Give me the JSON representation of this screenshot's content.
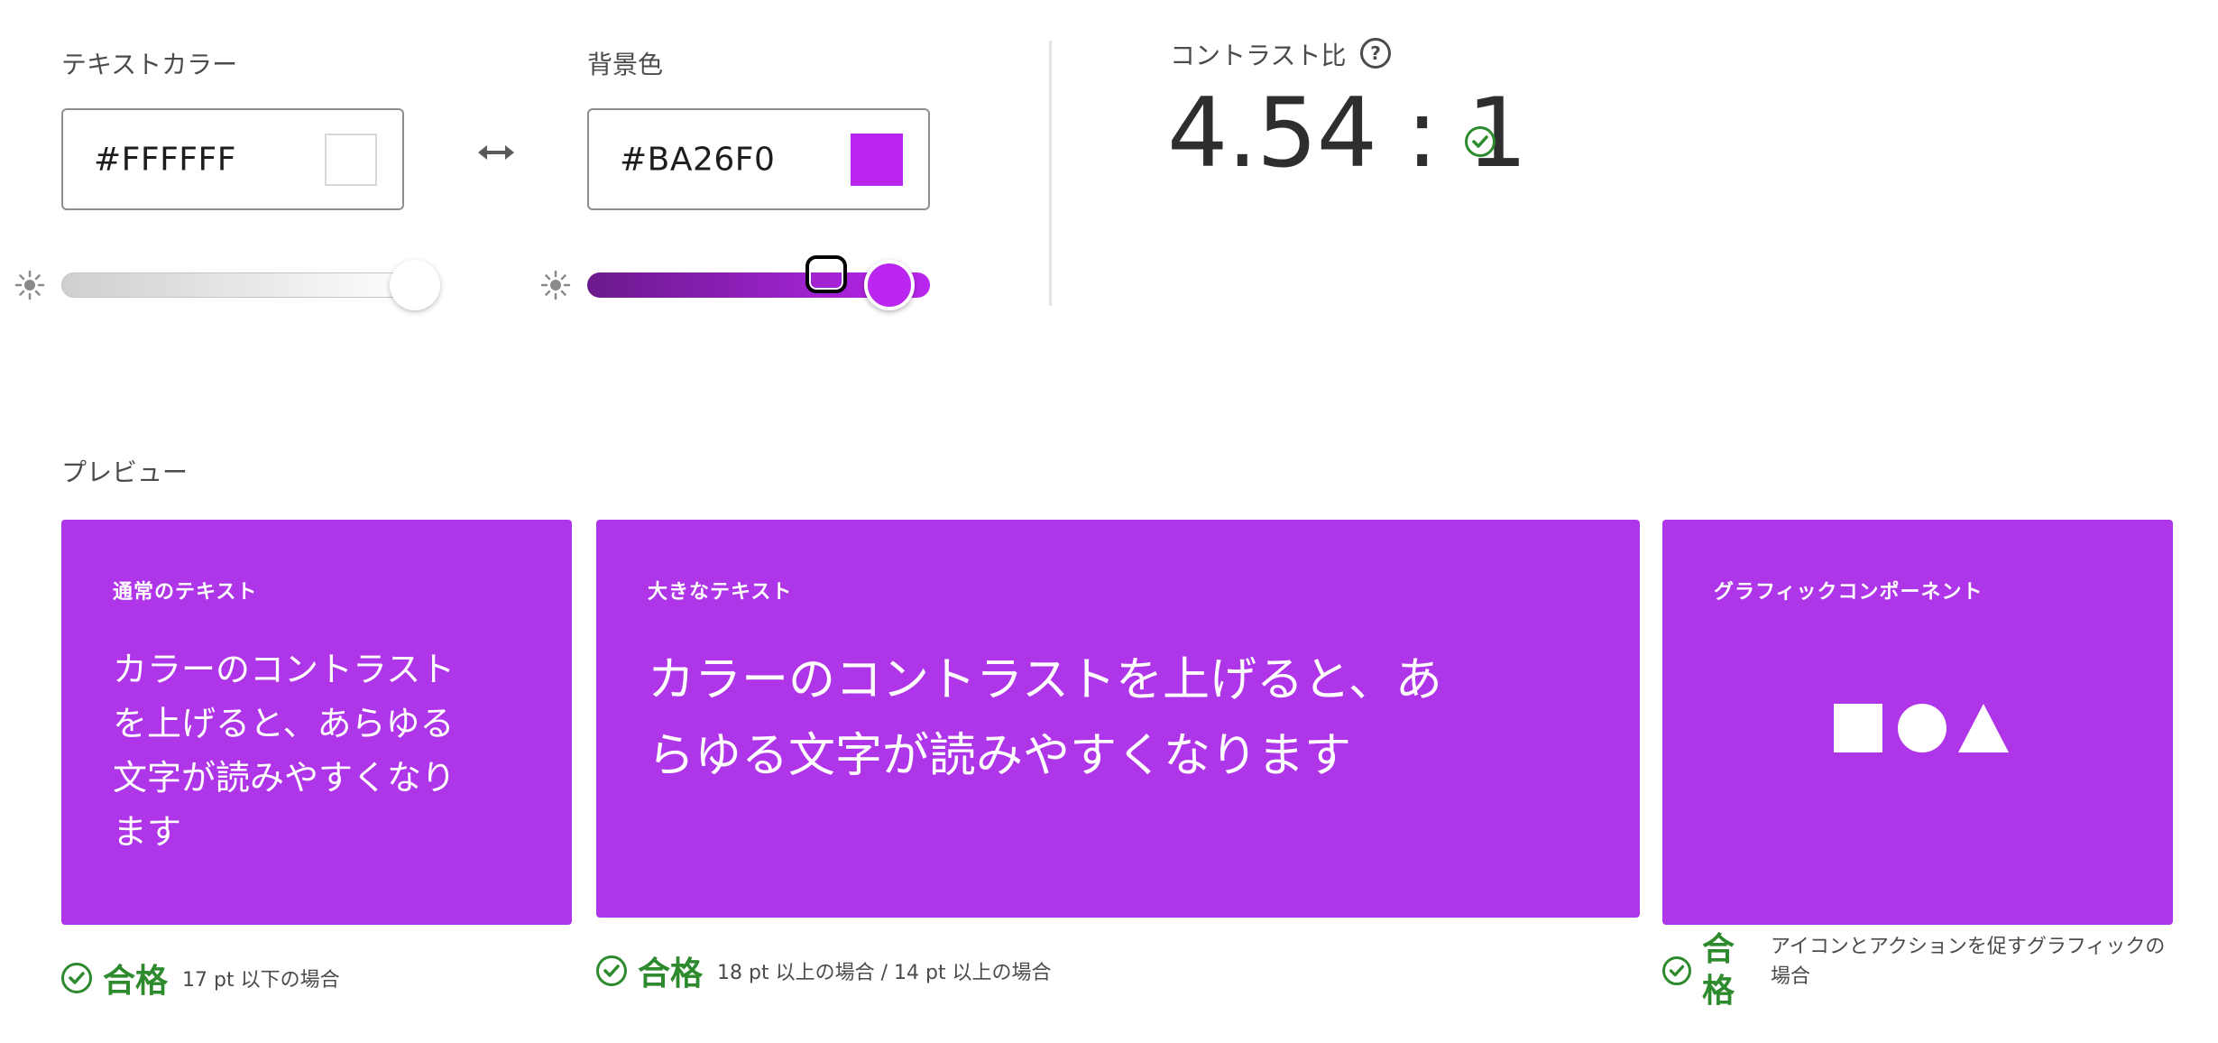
{
  "text_color": {
    "label": "テキストカラー",
    "hex": "#FFFFFF",
    "swatch": "#FFFFFF",
    "brightness_level": 1.0
  },
  "background_color": {
    "label": "背景色",
    "hex": "#BA26F0",
    "swatch": "#BA26F0",
    "brightness_level": 0.87
  },
  "swap_icon": "double-arrow-icon",
  "contrast": {
    "label": "コントラスト比",
    "help": "?",
    "value": "4.54 : 1",
    "status": "pass"
  },
  "preview": {
    "label": "プレビュー",
    "card_color": "#AF36E8",
    "cards": [
      {
        "title": "通常のテキスト",
        "sample_lines": [
          "カラーのコントラスト",
          "を上げると、あらゆる",
          "文字が読みやすくなり",
          "ます"
        ]
      },
      {
        "title": "大きなテキスト",
        "sample_lines": [
          "カラーのコントラストを上げると、あ",
          "らゆる文字が読みやすくなります"
        ]
      },
      {
        "title": "グラフィックコンポーネント",
        "shapes": [
          "square",
          "circle",
          "triangle"
        ]
      }
    ],
    "results": [
      {
        "status": "合格",
        "note": "17 pt 以下の場合"
      },
      {
        "status": "合格",
        "note": "18 pt 以上の場合 / 14 pt 以上の場合"
      },
      {
        "status_lines": [
          "合",
          "格"
        ],
        "note_lines": [
          "アイコンとアクションを促すグラフィックの",
          "場合"
        ]
      }
    ]
  },
  "colors": {
    "pass_green": "#2d8a2d",
    "text_dark": "#2e2e2e",
    "border": "#8e8e8e"
  }
}
